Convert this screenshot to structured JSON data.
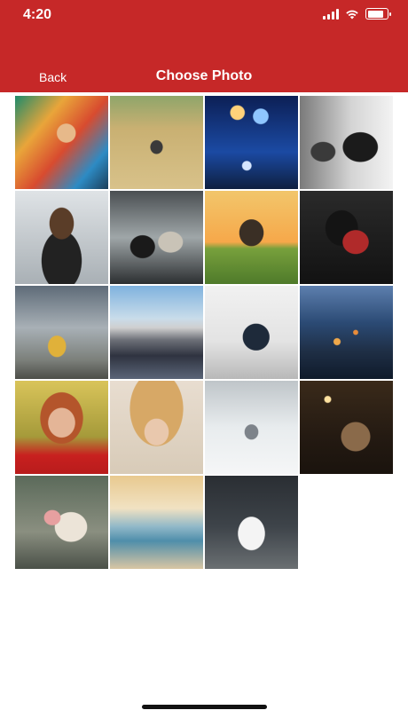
{
  "status": {
    "time": "4:20",
    "battery_level": 0.85
  },
  "header": {
    "back_label": "Back",
    "title": "Choose Photo"
  },
  "colors": {
    "header_bg": "#c62828",
    "text": "#ffffff"
  },
  "icons": [
    "signal-icon",
    "wifi-icon",
    "battery-icon"
  ],
  "photos": [
    {
      "name": "woman-colorful-wall"
    },
    {
      "name": "dog-wheat-field"
    },
    {
      "name": "child-balloons-night"
    },
    {
      "name": "woman-phone-bw"
    },
    {
      "name": "man-long-hair-car"
    },
    {
      "name": "couple-train-window"
    },
    {
      "name": "tree-sunset-field"
    },
    {
      "name": "woman-red-scarf-dark"
    },
    {
      "name": "woman-yellow-dress-sky"
    },
    {
      "name": "mountain-lake-reflection"
    },
    {
      "name": "laptop-code-desk"
    },
    {
      "name": "coastal-village-night"
    },
    {
      "name": "red-haired-woman-portrait"
    },
    {
      "name": "woman-straw-hat"
    },
    {
      "name": "woman-snowy-forest"
    },
    {
      "name": "couple-string-lights"
    },
    {
      "name": "couple-flower-crown"
    },
    {
      "name": "surfer-beach-sunset"
    },
    {
      "name": "white-sports-car"
    }
  ]
}
